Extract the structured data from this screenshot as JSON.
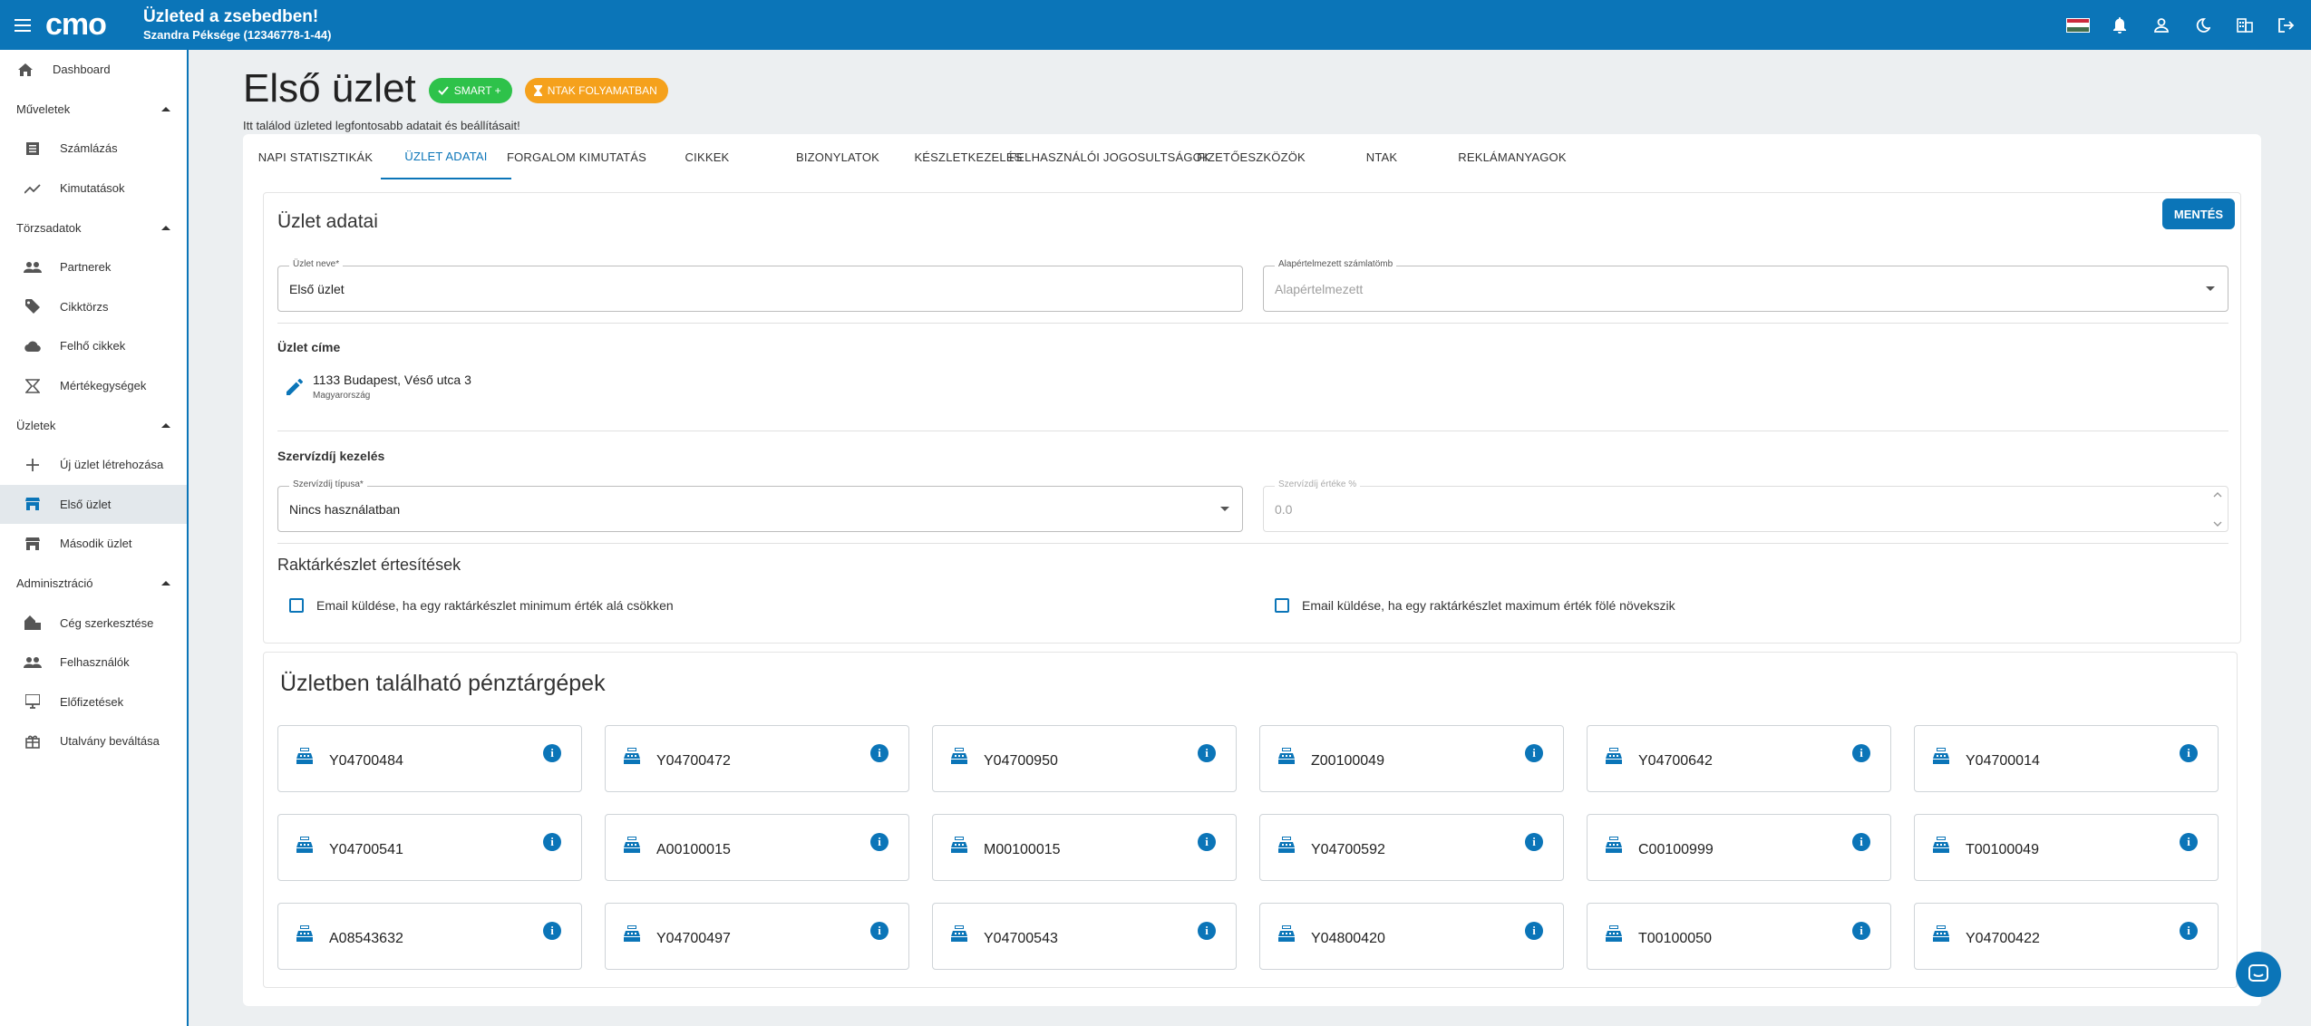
{
  "header": {
    "logo_text": "cmo",
    "title": "Üzleted a zsebedben!",
    "subtitle": "Szandra Péksége (12346778-1-44)"
  },
  "sidebar": {
    "dashboard": "Dashboard",
    "sections": [
      {
        "label": "Műveletek",
        "items": [
          "Számlázás",
          "Kimutatások"
        ]
      },
      {
        "label": "Törzsadatok",
        "items": [
          "Partnerek",
          "Cikktörzs",
          "Felhő cikkek",
          "Mértékegységek"
        ]
      },
      {
        "label": "Üzletek",
        "items": [
          "Új üzlet létrehozása",
          "Első üzlet",
          "Második üzlet"
        ]
      },
      {
        "label": "Adminisztráció",
        "items": [
          "Cég szerkesztése",
          "Felhasználók",
          "Előfizetések",
          "Utalvány beváltása"
        ]
      }
    ],
    "active_item": "Első üzlet"
  },
  "page": {
    "title": "Első üzlet",
    "badge_smart": "SMART +",
    "badge_ntak": "NTAK FOLYAMATBAN",
    "subtitle": "Itt találod üzleted legfontosabb adatait és beállításait!"
  },
  "tabs": [
    "NAPI STATISZTIKÁK",
    "ÜZLET ADATAI",
    "FORGALOM KIMUTATÁS",
    "CIKKEK",
    "BIZONYLATOK",
    "KÉSZLETKEZELÉS",
    "FELHASZNÁLÓI JOGOSULTSÁGOK",
    "FIZETŐESZKÖZÖK",
    "NTAK",
    "REKLÁMANYAGOK"
  ],
  "active_tab": "ÜZLET ADATAI",
  "form": {
    "section_title": "Üzlet adatai",
    "save_label": "MENTÉS",
    "shop_name_label": "Üzlet neve*",
    "shop_name_value": "Első üzlet",
    "invoice_block_label": "Alapértelmezett számlatömb",
    "invoice_block_placeholder": "Alapértelmezett",
    "address_title": "Üzlet címe",
    "address_line": "1133 Budapest, Véső utca 3",
    "address_country": "Magyarország",
    "service_title": "Szervízdíj kezelés",
    "service_type_label": "Szervízdíj típusa*",
    "service_type_value": "Nincs használatban",
    "service_value_label": "Szervízdíj értéke %",
    "service_value_value": "0.0",
    "stock_title": "Raktárkészlet értesítések",
    "check_min": "Email küldése, ha egy raktárkészlet minimum érték alá csökken",
    "check_max": "Email küldése, ha egy raktárkészlet maximum érték fölé növekszik"
  },
  "registers": {
    "title": "Üzletben található pénztárgépek",
    "items": [
      "Y04700484",
      "Y04700472",
      "Y04700950",
      "Z00100049",
      "Y04700642",
      "Y04700014",
      "Y04700541",
      "A00100015",
      "M00100015",
      "Y04700592",
      "C00100999",
      "T00100049",
      "A08543632",
      "Y04700497",
      "Y04700543",
      "Y04800420",
      "T00100050",
      "Y04700422"
    ],
    "info_glyph": "i"
  },
  "colors": {
    "primary": "#0b75b8",
    "smart_badge": "#2ec24a",
    "ntak_badge": "#f5a11c"
  }
}
